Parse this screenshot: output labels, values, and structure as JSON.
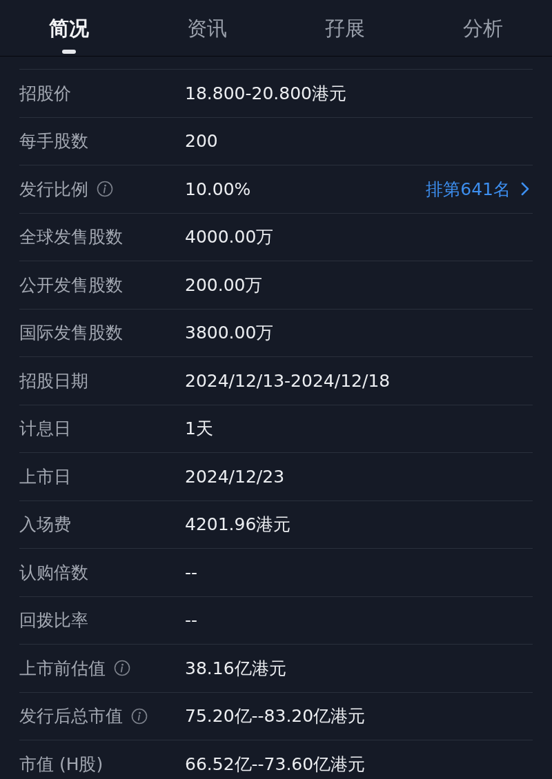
{
  "tabs": [
    {
      "label": "简况",
      "selected": true
    },
    {
      "label": "资讯",
      "selected": false
    },
    {
      "label": "孖展",
      "selected": false
    },
    {
      "label": "分析",
      "selected": false
    }
  ],
  "rows": [
    {
      "label": "招股价",
      "value": "18.800-20.800港元",
      "info": false
    },
    {
      "label": "每手股数",
      "value": "200",
      "info": false
    },
    {
      "label": "发行比例",
      "value": "10.00%",
      "info": true,
      "link": "排第641名"
    },
    {
      "label": "全球发售股数",
      "value": "4000.00万",
      "info": false
    },
    {
      "label": "公开发售股数",
      "value": "200.00万",
      "info": false
    },
    {
      "label": "国际发售股数",
      "value": "3800.00万",
      "info": false
    },
    {
      "label": "招股日期",
      "value": "2024/12/13-2024/12/18",
      "info": false
    },
    {
      "label": "计息日",
      "value": "1天",
      "info": false
    },
    {
      "label": "上市日",
      "value": "2024/12/23",
      "info": false
    },
    {
      "label": "入场费",
      "value": "4201.96港元",
      "info": false
    },
    {
      "label": "认购倍数",
      "value": "--",
      "info": false
    },
    {
      "label": "回拨比率",
      "value": "--",
      "info": false
    },
    {
      "label": "上市前估值",
      "value": "38.16亿港元",
      "info": true
    },
    {
      "label": "发行后总市值",
      "value": "75.20亿--83.20亿港元",
      "info": true
    },
    {
      "label": "市值 (H股)",
      "value": "66.52亿--73.60亿港元",
      "info": false
    }
  ]
}
